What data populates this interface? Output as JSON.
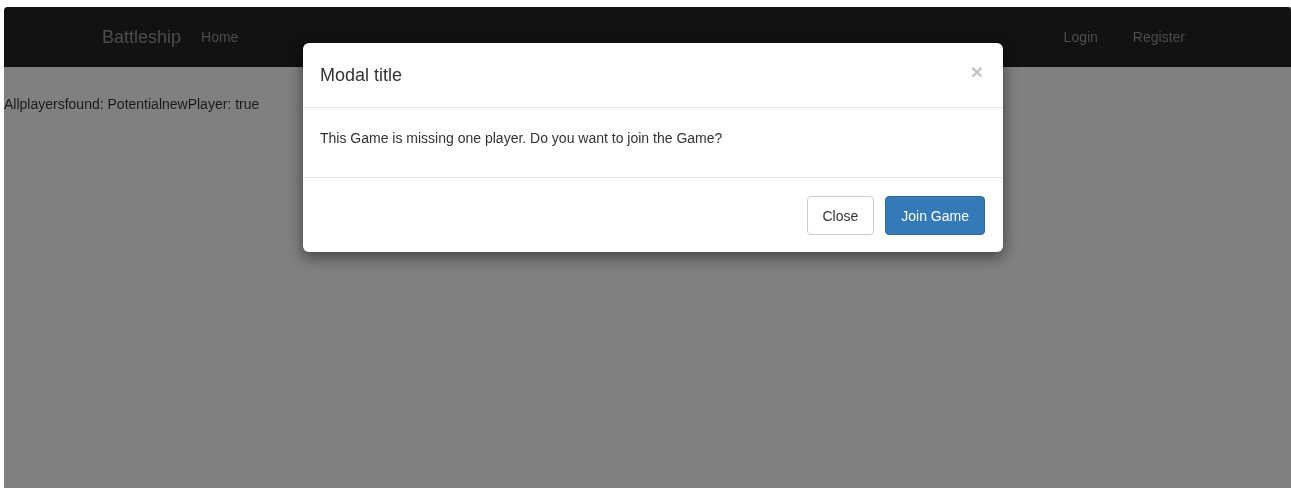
{
  "navbar": {
    "brand": "Battleship",
    "left_links": [
      {
        "label": "Home"
      }
    ],
    "right_links": [
      {
        "label": "Login"
      },
      {
        "label": "Register"
      }
    ]
  },
  "status_text": "Allplayersfound: PotentialnewPlayer: true",
  "modal": {
    "title": "Modal title",
    "close_glyph": "×",
    "body": "This Game is missing one player. Do you want to join the Game?",
    "buttons": [
      {
        "label": "Close",
        "kind": "default"
      },
      {
        "label": "Join Game",
        "kind": "primary"
      }
    ]
  }
}
